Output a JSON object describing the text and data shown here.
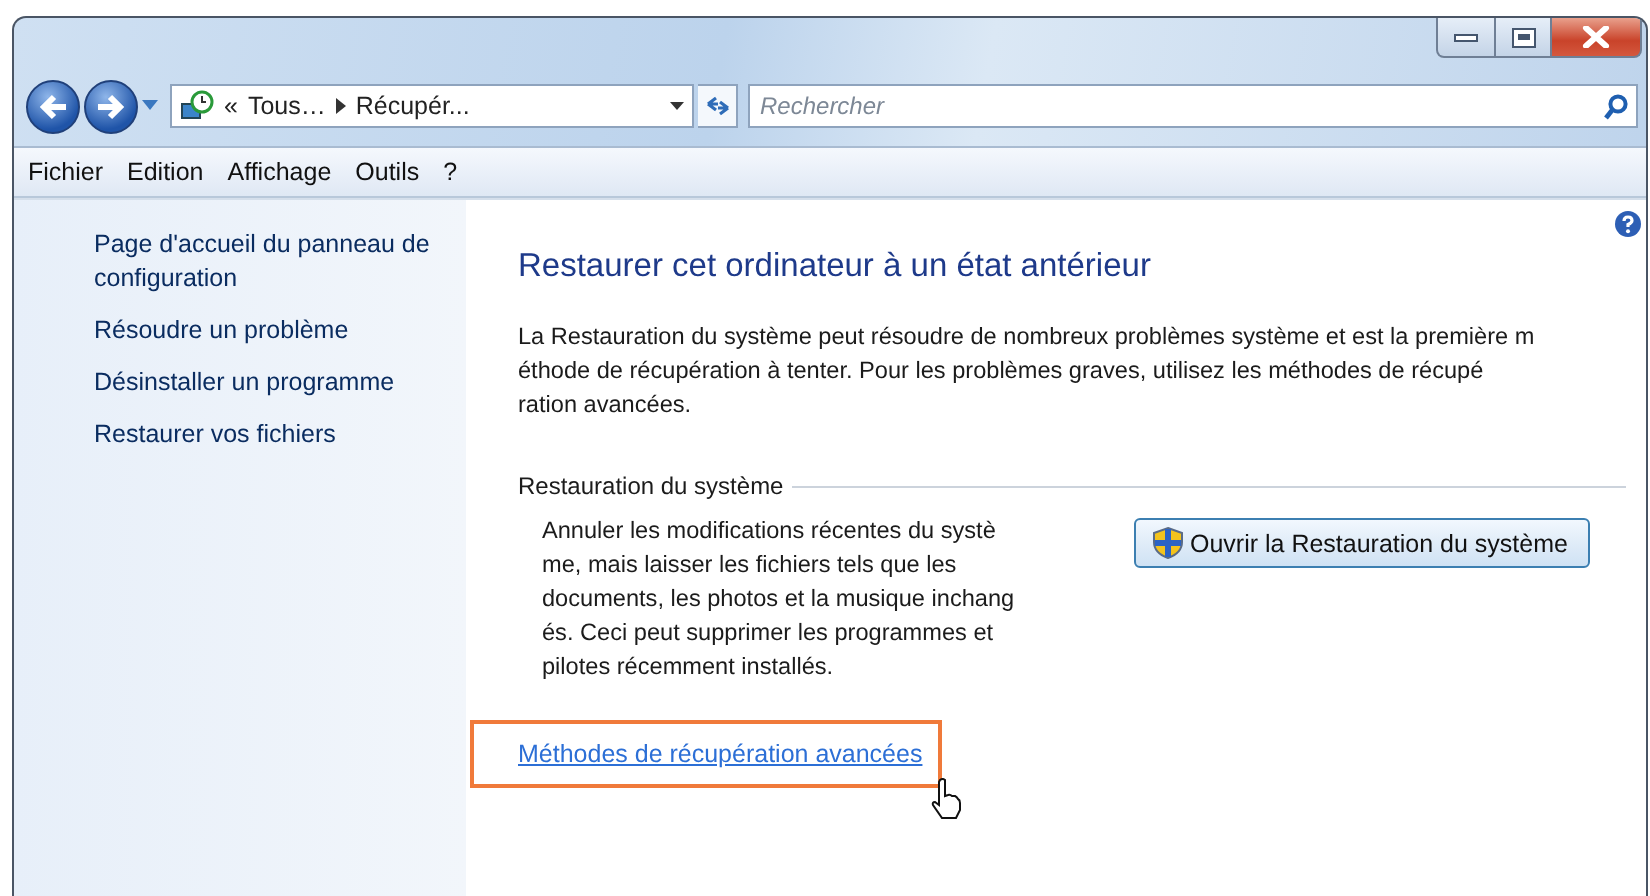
{
  "address_bar": {
    "overflow": "«",
    "crumbs": [
      "Tous…",
      "Récupér..."
    ]
  },
  "search": {
    "placeholder": "Rechercher"
  },
  "menu": [
    "Fichier",
    "Edition",
    "Affichage",
    "Outils",
    "?"
  ],
  "sidebar": {
    "items": [
      "Page d'accueil du panneau de configuration",
      "Résoudre un problème",
      "Désinstaller un programme",
      "Restaurer vos fichiers"
    ]
  },
  "main": {
    "title": "Restaurer cet ordinateur à un état antérieur",
    "description_lines": [
      "La Restauration du système peut résoudre de nombreux problèmes système et est la première m",
      "éthode de récupération à tenter. Pour les problèmes graves, utilisez les méthodes de récupé",
      "ration avancées."
    ],
    "section": {
      "title": "Restauration du système",
      "text_lines": [
        "Annuler les modifications récentes du systè",
        "me, mais laisser les fichiers tels que les",
        "documents, les photos et la musique inchang",
        "és. Ceci peut supprimer les programmes et",
        "pilotes récemment installés."
      ],
      "button": "Ouvrir la Restauration du système"
    },
    "link": {
      "label": "Méthodes de récupération avancées",
      "highlighted": true
    }
  }
}
